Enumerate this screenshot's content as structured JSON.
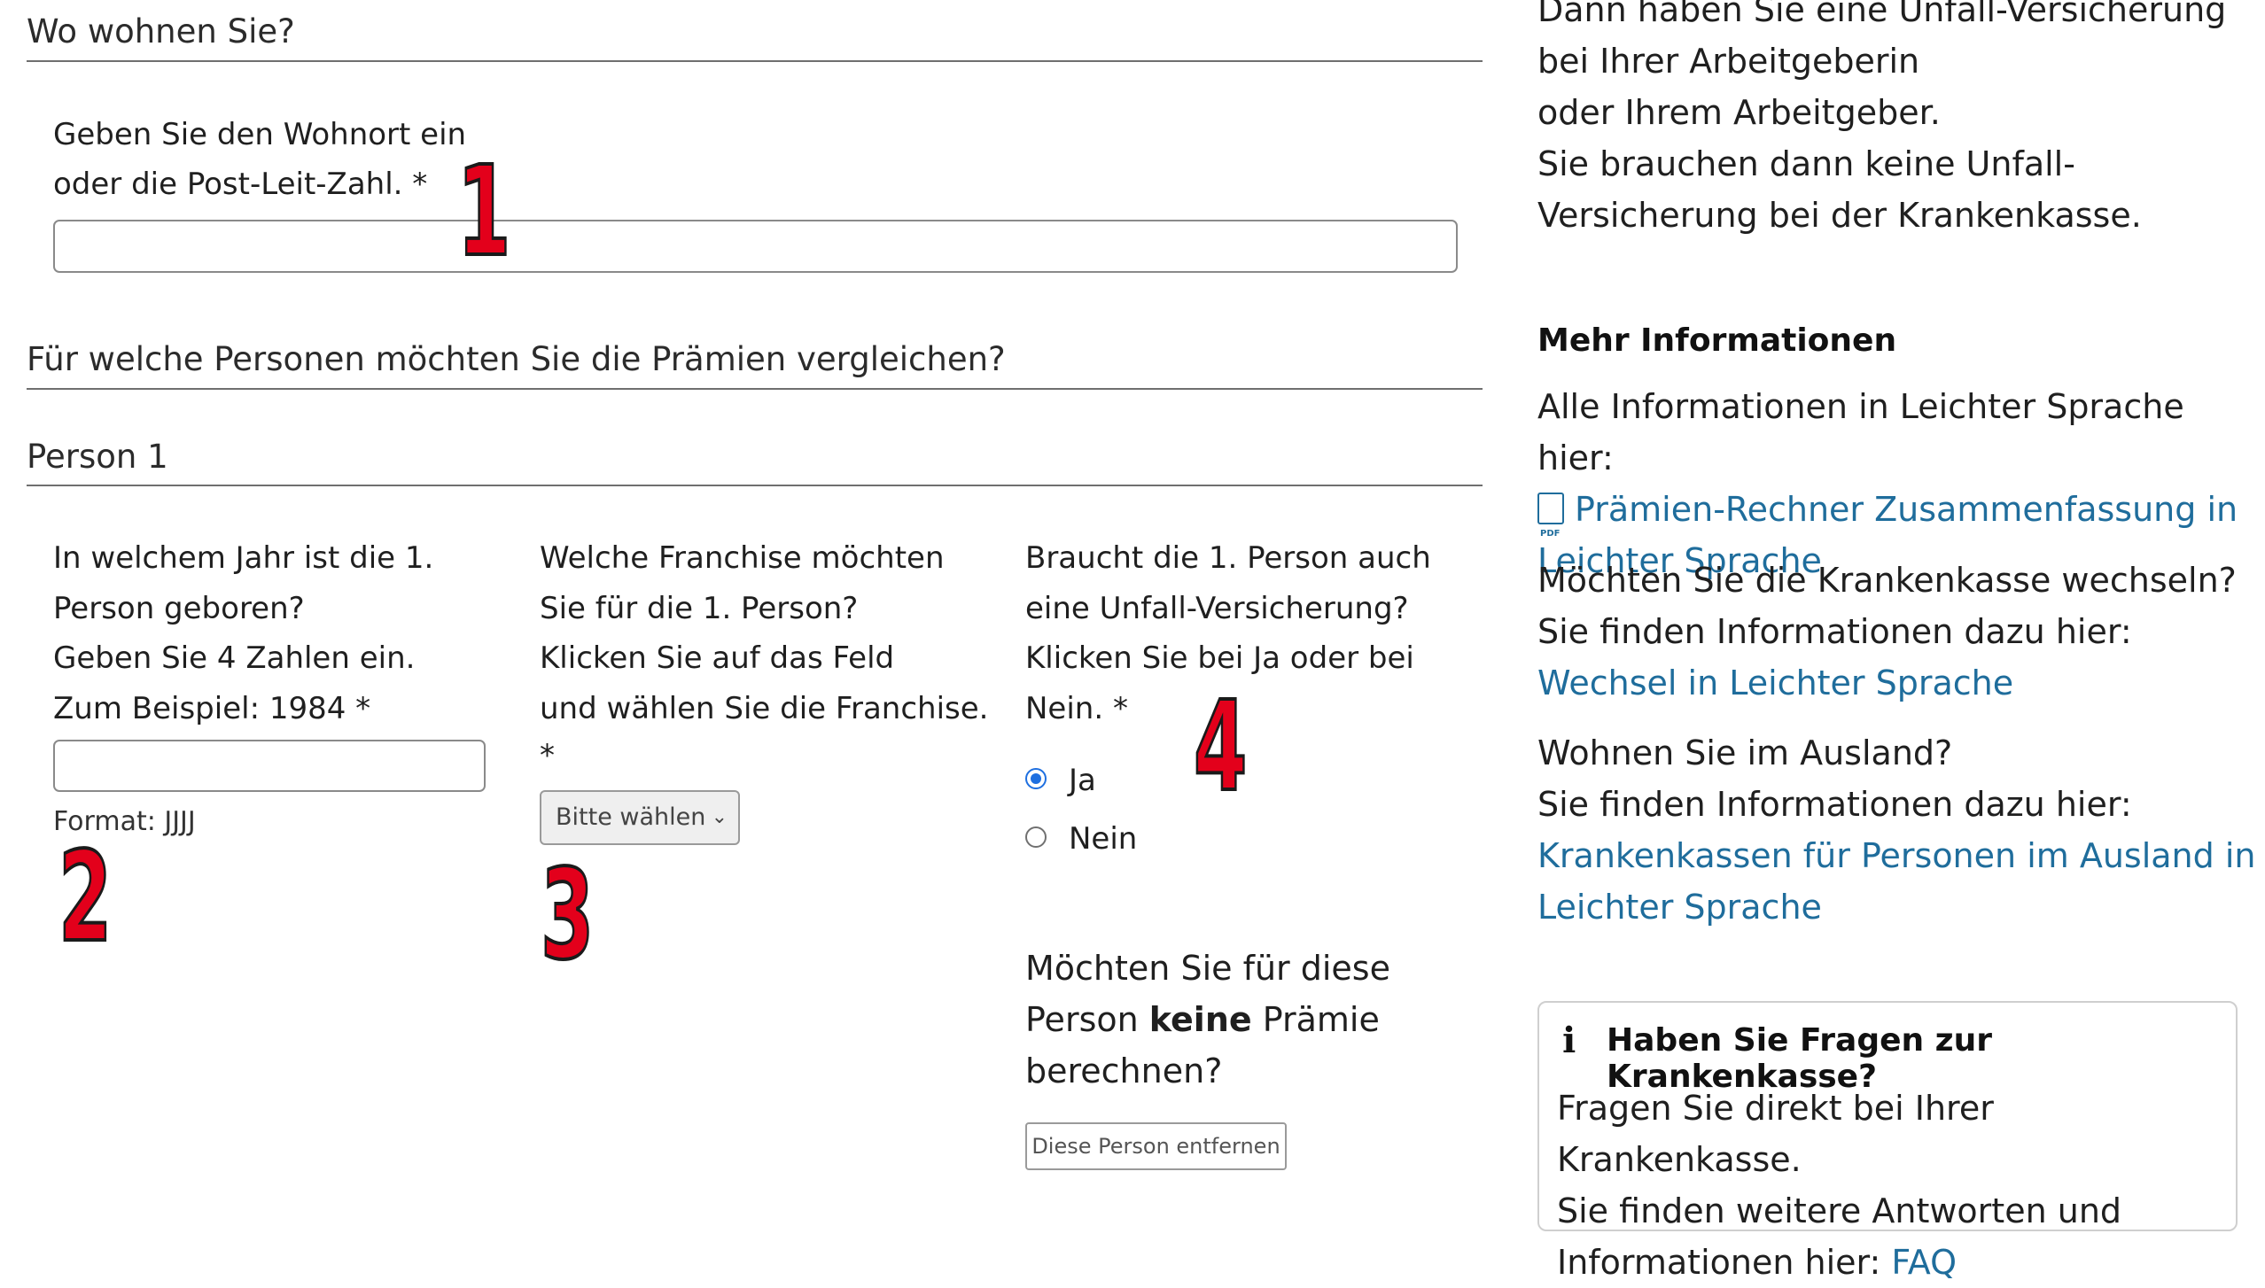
{
  "residence": {
    "heading": "Wo wohnen Sie?",
    "label_line1": "Geben Sie den Wohnort ein",
    "label_line2": "oder die Post-Leit-Zahl. *",
    "input_value": ""
  },
  "persons_heading": "Für welche Personen möchten Sie die Prämien vergleichen?",
  "person1": {
    "heading": "Person 1",
    "birth": {
      "lines": [
        "In welchem Jahr ist die 1.",
        "Person geboren?",
        "Geben Sie 4 Zahlen ein.",
        "Zum Beispiel: 1984 *"
      ],
      "input_value": "",
      "hint": "Format: JJJJ"
    },
    "franchise": {
      "lines": [
        "Welche Franchise möchten",
        "Sie für die 1. Person?",
        "Klicken Sie auf das Feld",
        "und wählen Sie die Franchise.",
        "*"
      ],
      "select_value": "Bitte wählen"
    },
    "accident": {
      "lines": [
        "Braucht die 1. Person auch",
        "eine Unfall-Versicherung?",
        "Klicken Sie bei Ja oder bei",
        "Nein. *"
      ],
      "options": [
        {
          "label": "Ja",
          "selected": true
        },
        {
          "label": "Nein",
          "selected": false
        }
      ]
    },
    "remove": {
      "line1": "Möchten Sie für diese",
      "line2_pre": "Person ",
      "line2_bold": "keine",
      "line2_post": " Prämie",
      "line3": "berechnen?",
      "button_label": "Diese Person entfernen"
    }
  },
  "markers": [
    "1",
    "2",
    "3",
    "4"
  ],
  "sidebar": {
    "intro_lines": [
      "Dann haben Sie eine Unfall-Versicherung",
      "bei Ihrer Arbeitgeberin",
      "oder Ihrem Arbeitgeber.",
      "Sie brauchen dann keine Unfall-",
      "Versicherung bei der Krankenkasse."
    ],
    "more_info_heading": "Mehr Informationen",
    "info1_text": "Alle Informationen in Leichter Sprache hier:",
    "info1_link_line1": "Prämien-Rechner Zusammenfassung in",
    "info1_link_line2": "Leichter Sprache",
    "pdf_icon_text": "PDF",
    "info2_line1": "Möchten Sie die Krankenkasse wechseln?",
    "info2_line2": "Sie finden Informationen dazu hier:",
    "info2_link": "Wechsel in Leichter Sprache",
    "info3_line1": "Wohnen Sie im Ausland?",
    "info3_line2": "Sie finden Informationen dazu hier:",
    "info3_link_line1": "Krankenkassen für Personen im Ausland in",
    "info3_link_line2": "Leichter Sprache",
    "box": {
      "icon": "info-icon",
      "title": "Haben Sie Fragen zur Krankenkasse?",
      "line1": "Fragen Sie direkt bei Ihrer Krankenkasse.",
      "line2": "Sie finden weitere Antworten und",
      "line3_pre": "Informationen hier: ",
      "line3_link": "FAQ"
    }
  },
  "colors": {
    "link": "#1f6d9c",
    "radio_selected": "#1e6fe0",
    "marker_red": "#e3001b"
  }
}
